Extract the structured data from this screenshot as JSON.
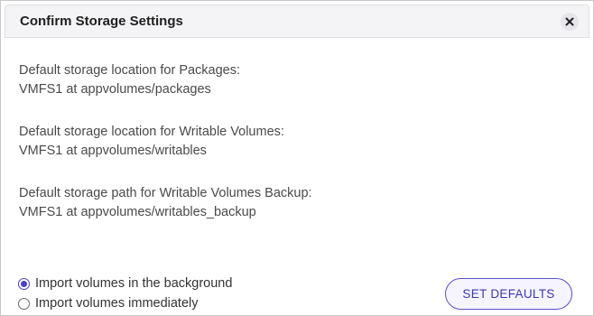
{
  "dialog": {
    "title": "Confirm Storage Settings",
    "close_icon": "close-icon"
  },
  "settings": [
    {
      "label": "Default storage location for Packages:",
      "value": "VMFS1 at appvolumes/packages"
    },
    {
      "label": "Default storage location for Writable Volumes:",
      "value": "VMFS1 at appvolumes/writables"
    },
    {
      "label": "Default storage path for Writable Volumes Backup:",
      "value": "VMFS1 at appvolumes/writables_backup"
    }
  ],
  "import_options": [
    {
      "label": "Import volumes in the background",
      "selected": true
    },
    {
      "label": "Import volumes immediately",
      "selected": false
    }
  ],
  "actions": {
    "set_defaults_label": "SET DEFAULTS"
  },
  "colors": {
    "accent": "#4a3fc8",
    "header_bg": "#f4f4f6"
  }
}
